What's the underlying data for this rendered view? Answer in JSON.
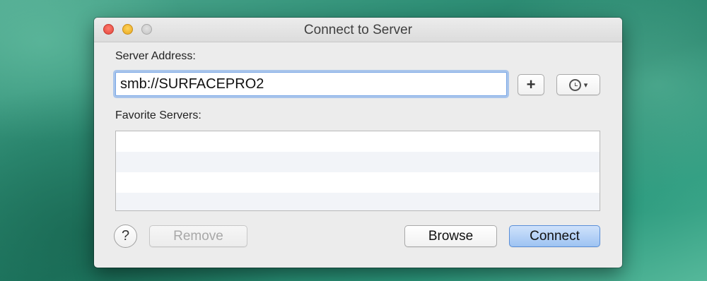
{
  "window": {
    "title": "Connect to Server"
  },
  "server_address": {
    "label": "Server Address:",
    "value": "smb://SURFACEPRO2",
    "add_button_label": "+",
    "recent_icon": "clock-icon",
    "recent_caret": "▾"
  },
  "favorites": {
    "label": "Favorite Servers:",
    "items": []
  },
  "footer": {
    "help_label": "?",
    "remove_label": "Remove",
    "browse_label": "Browse",
    "connect_label": "Connect"
  },
  "colors": {
    "accent_focus": "#7aa7e6",
    "default_button": "#9ec3f2",
    "close": "#e0443a",
    "minimize": "#e6a71f",
    "zoom": "#c4c4c4"
  }
}
